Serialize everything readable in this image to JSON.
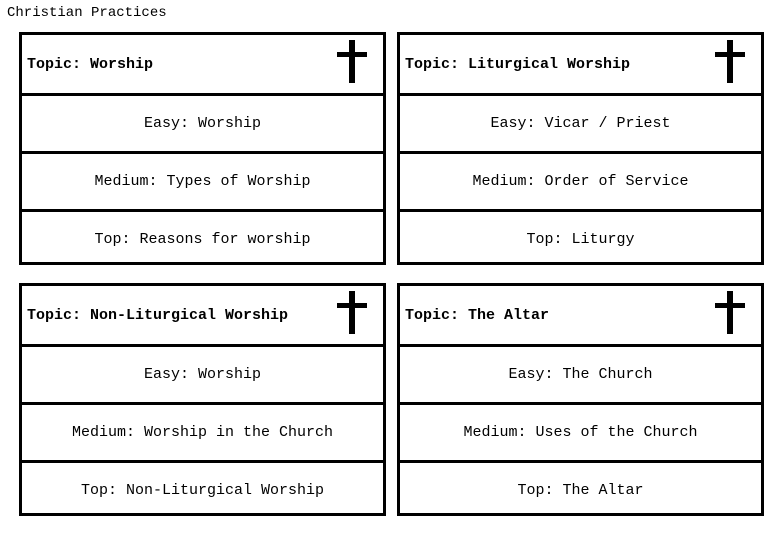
{
  "page": {
    "title": "Christian Practices"
  },
  "cards": [
    {
      "topic": "Topic: Worship",
      "easy": "Easy: Worship",
      "medium": "Medium: Types of Worship",
      "top": "Top: Reasons for worship",
      "icon": "cross-icon"
    },
    {
      "topic": "Topic: Liturgical Worship",
      "easy": "Easy: Vicar / Priest",
      "medium": "Medium: Order of Service",
      "top": "Top: Liturgy",
      "icon": "cross-icon"
    },
    {
      "topic": "Topic: Non-Liturgical Worship",
      "easy": "Easy: Worship",
      "medium": "Medium: Worship in the Church",
      "top": "Top: Non-Liturgical Worship",
      "icon": "cross-icon"
    },
    {
      "topic": "Topic: The Altar",
      "easy": "Easy: The Church",
      "medium": "Medium: Uses of the Church",
      "top": "Top: The Altar",
      "icon": "cross-icon"
    }
  ]
}
